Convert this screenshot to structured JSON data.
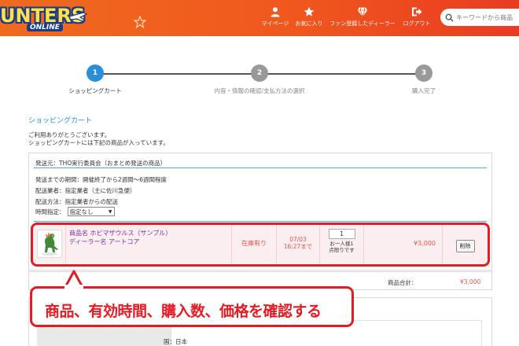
{
  "header": {
    "logo_text": "UNTERS",
    "logo_sub": "ONLINE",
    "nav": {
      "mypage": "マイページ",
      "favorites": "お気に入り",
      "fan_dealers": "ファン登録したディーラー",
      "logout": "ログアウト"
    },
    "search_placeholder": "キーワードから商品"
  },
  "steps": [
    {
      "number": "1",
      "label": "ショッピングカート"
    },
    {
      "number": "2",
      "label": "内容・情報の確認/支払方法の選択"
    },
    {
      "number": "3",
      "label": "購入完了"
    }
  ],
  "page": {
    "title": "ショッピングカート",
    "intro_line1": "ご利用ありがとうございます。",
    "intro_line2": "ショッピングカートには下記の商品が入っています。"
  },
  "shipping": {
    "title": "発送元：THO実行委員会（おまとめ発送の商品）",
    "period": "発送までの期間：開催終了から2週間〜6週間程度",
    "carrier": "配送業者：指定業者（主に佐川急便）",
    "method": "配送方法：指定業者からの配送",
    "time_label": "時間指定：",
    "time_selected": "指定なし"
  },
  "product": {
    "name": "商品名 ホビマザウルス（サンプル）",
    "dealer": "ディーラー名 アートコア",
    "stock": "在庫有り",
    "expire_date": "07/03",
    "expire_time": "16:27まで",
    "quantity": "1",
    "qty_note1": "お一人様1",
    "qty_note2": "点限りです",
    "price": "¥3,000",
    "delete_label": "削除"
  },
  "totals": {
    "label": "商品合計：",
    "value": "¥3,000"
  },
  "lower": {
    "country": "国：日本"
  },
  "callout": {
    "text": "商品、有効時間、購入数、価格を確認する"
  },
  "colors": {
    "accent_blue": "#2b8fd8",
    "header_orange": "#f0581e",
    "callout_red": "#e51b23",
    "price_red": "#e5554a",
    "product_purple": "#7a2fa0"
  }
}
